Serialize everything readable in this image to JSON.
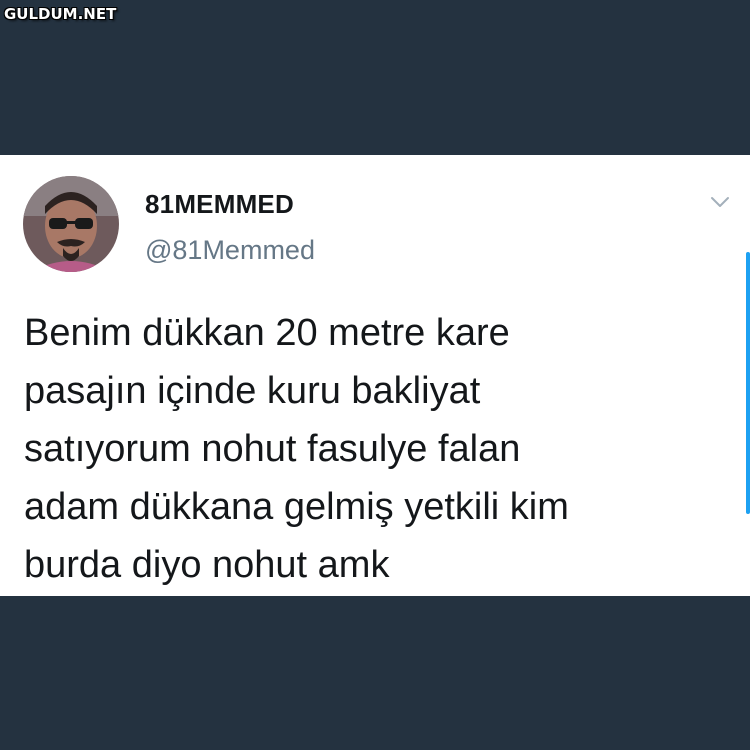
{
  "watermark": "GULDUM.NET",
  "tweet": {
    "display_name": "81MEMMED",
    "handle": "@81Memmed",
    "text_lines": [
      "Benim dükkan 20 metre kare",
      "pasajın içinde kuru bakliyat",
      "satıyorum nohut fasulye falan",
      "adam dükkana gelmiş yetkili kim",
      "burda diyo nohut amk"
    ]
  },
  "icons": {
    "menu": "chevron-down-icon",
    "avatar": "avatar"
  },
  "colors": {
    "background": "#243240",
    "card": "#ffffff",
    "text": "#14171a",
    "handle": "#657786",
    "scrollbar": "#1da1f2"
  }
}
